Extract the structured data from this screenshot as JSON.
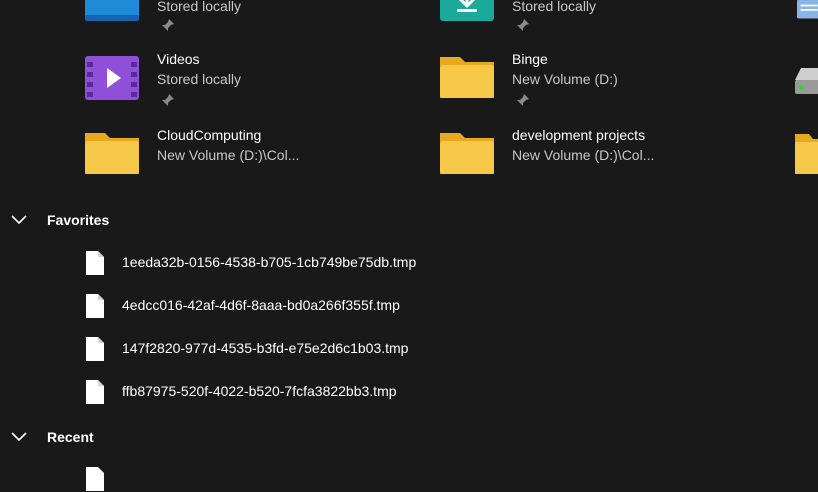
{
  "quick_access": {
    "row0": [
      {
        "subtitle": "Stored locally",
        "icon": "blue-folder-icon"
      },
      {
        "subtitle": "Stored locally",
        "icon": "downloads-folder-icon"
      }
    ],
    "items": [
      {
        "name": "Videos",
        "subtitle": "Stored locally",
        "icon": "videos-folder-icon",
        "pinned": true
      },
      {
        "name": "Binge",
        "subtitle": "New Volume (D:)",
        "icon": "folder-icon",
        "pinned": true
      },
      {
        "name": "CloudComputing",
        "subtitle": "New Volume (D:)\\Col...",
        "icon": "folder-icon",
        "pinned": false
      },
      {
        "name": "development projects",
        "subtitle": "New Volume (D:)\\Col...",
        "icon": "folder-icon",
        "pinned": false
      }
    ],
    "right_edge_icons": [
      "documents-folder-icon",
      "drive-icon",
      "folder-icon"
    ]
  },
  "favorites": {
    "title": "Favorites",
    "files": [
      "1eeda32b-0156-4538-b705-1cb749be75db.tmp",
      "4edcc016-42af-4d6f-8aaa-bd0a266f355f.tmp",
      "147f2820-977d-4535-b3fd-e75e2d6c1b03.tmp",
      "ffb87975-520f-4022-b520-7fcfa3822bb3.tmp"
    ]
  },
  "recent": {
    "title": "Recent"
  },
  "colors": {
    "background": "#191919",
    "folder_yellow": "#f6c847",
    "videos_purple": "#8f4fd6",
    "downloads_teal": "#1aa99a",
    "blue_folder": "#1f8ad8"
  }
}
